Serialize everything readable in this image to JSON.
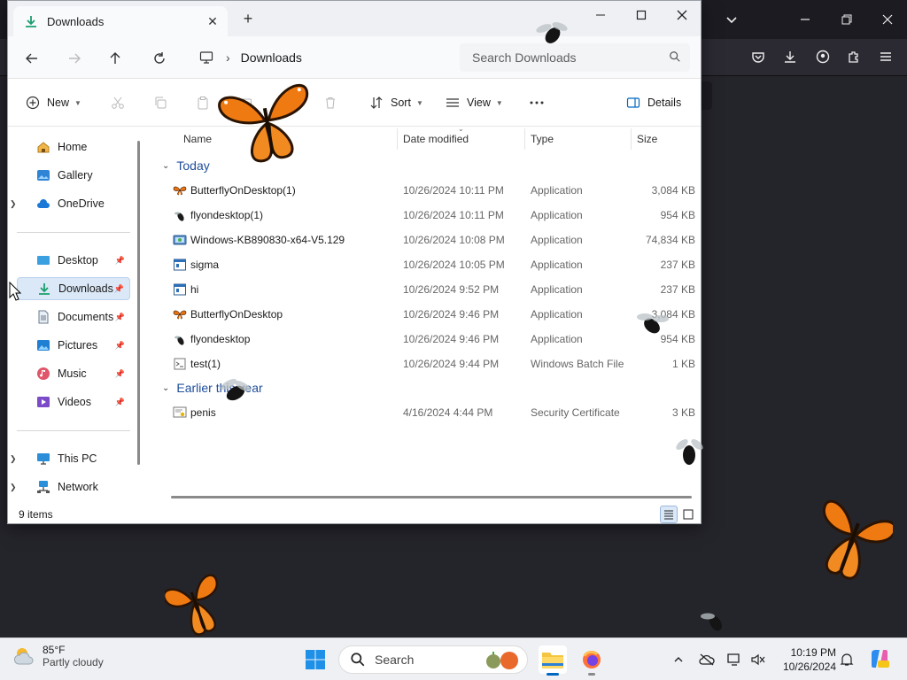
{
  "explorer": {
    "tab_title": "Downloads",
    "address": {
      "location": "Downloads"
    },
    "search_placeholder": "Search Downloads",
    "commands": {
      "new": "New",
      "sort": "Sort",
      "view": "View",
      "details": "Details"
    },
    "sidebar": {
      "items": [
        {
          "label": "Home",
          "icon": "home-icon"
        },
        {
          "label": "Gallery",
          "icon": "gallery-icon"
        },
        {
          "label": "OneDrive",
          "icon": "cloud-icon"
        },
        {
          "label": "Desktop",
          "icon": "desktop-icon"
        },
        {
          "label": "Downloads",
          "icon": "download-icon"
        },
        {
          "label": "Documents",
          "icon": "documents-icon"
        },
        {
          "label": "Pictures",
          "icon": "pictures-icon"
        },
        {
          "label": "Music",
          "icon": "music-icon"
        },
        {
          "label": "Videos",
          "icon": "videos-icon"
        },
        {
          "label": "This PC",
          "icon": "pc-icon"
        },
        {
          "label": "Network",
          "icon": "network-icon"
        }
      ]
    },
    "columns": {
      "name": "Name",
      "date": "Date modified",
      "type": "Type",
      "size": "Size"
    },
    "groups": {
      "today": "Today",
      "earlier": "Earlier this year"
    },
    "files_today": [
      {
        "name": "ButterflyOnDesktop(1)",
        "date": "10/26/2024 10:11 PM",
        "type": "Application",
        "size": "3,084 KB",
        "icon": "butterfly-app-icon"
      },
      {
        "name": "flyondesktop(1)",
        "date": "10/26/2024 10:11 PM",
        "type": "Application",
        "size": "954 KB",
        "icon": "fly-app-icon"
      },
      {
        "name": "Windows-KB890830-x64-V5.129",
        "date": "10/26/2024 10:08 PM",
        "type": "Application",
        "size": "74,834 KB",
        "icon": "installer-icon"
      },
      {
        "name": "sigma",
        "date": "10/26/2024 10:05 PM",
        "type": "Application",
        "size": "237 KB",
        "icon": "exe-icon"
      },
      {
        "name": "hi",
        "date": "10/26/2024 9:52 PM",
        "type": "Application",
        "size": "237 KB",
        "icon": "exe-icon"
      },
      {
        "name": "ButterflyOnDesktop",
        "date": "10/26/2024 9:46 PM",
        "type": "Application",
        "size": "3,084 KB",
        "icon": "butterfly-app-icon"
      },
      {
        "name": "flyondesktop",
        "date": "10/26/2024 9:46 PM",
        "type": "Application",
        "size": "954 KB",
        "icon": "fly-app-icon"
      },
      {
        "name": "test(1)",
        "date": "10/26/2024 9:44 PM",
        "type": "Windows Batch File",
        "size": "1 KB",
        "icon": "batch-file-icon"
      }
    ],
    "files_earlier": [
      {
        "name": "penis",
        "date": "4/16/2024 4:44 PM",
        "type": "Security Certificate",
        "size": "3 KB",
        "icon": "certificate-icon"
      }
    ],
    "status": {
      "item_count": "9 items"
    }
  },
  "taskbar": {
    "weather": {
      "temp": "85°F",
      "condition": "Partly cloudy"
    },
    "search_label": "Search",
    "clock": {
      "time": "10:19 PM",
      "date": "10/26/2024"
    }
  },
  "colors": {
    "accent": "#0067c0",
    "group_header": "#1f4e9c",
    "selection": "#dbe8f7",
    "desktop_bg": "#24242b",
    "butterfly_orange": "#f07a12"
  }
}
